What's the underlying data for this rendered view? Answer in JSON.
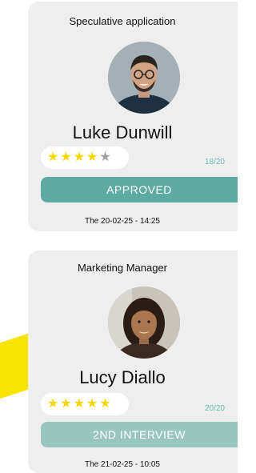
{
  "colors": {
    "card_bg": "#efeeef",
    "approved": "#5daba0",
    "second_interview": "#98c7bf",
    "star_filled": "#f6d500",
    "star_empty": "#9e9e9e",
    "accent_yellow": "#f7e300"
  },
  "cards": [
    {
      "job_title": "Speculative application",
      "name": "Luke Dunwill",
      "avatar_icon": "person-photo-icon",
      "stars_filled": 4,
      "stars_total": 5,
      "score": "18/20",
      "status": "APPROVED",
      "date": "The 20-02-25 - 14:25"
    },
    {
      "job_title": "Marketing Manager",
      "name": "Lucy Diallo",
      "avatar_icon": "person-photo-icon",
      "stars_filled": 5,
      "stars_total": 5,
      "score": "20/20",
      "status": "2ND INTERVIEW",
      "date": "The 21-02-25 - 10:05"
    }
  ]
}
